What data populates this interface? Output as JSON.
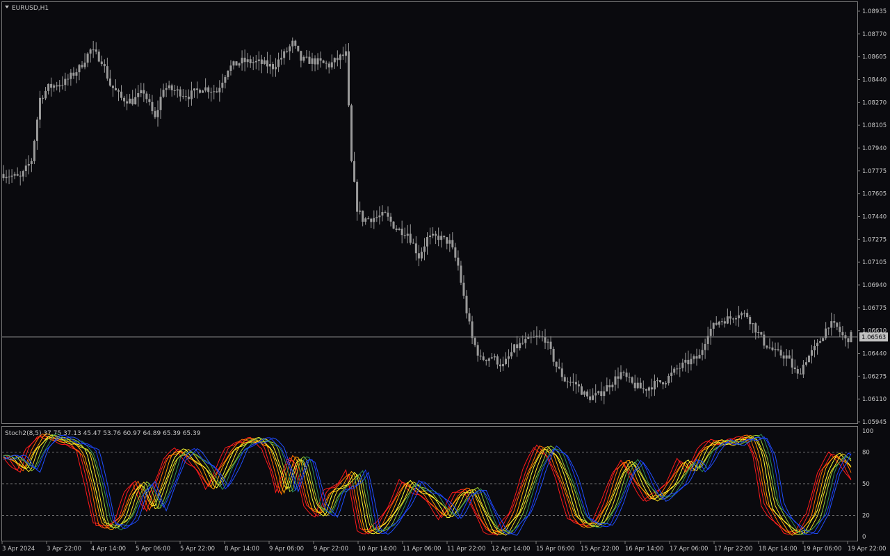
{
  "window": {
    "symbol_label": "EURUSD,H1",
    "current_price": "1.06563",
    "indicator_label": "Stoch2(8,5) 37.75 37.13 45.47 53.76 60.97 64.89 65.39 65.39"
  },
  "colors": {
    "background": "#0a0a0e",
    "frame": "#7a7a7a",
    "candle": "#9a9a9a",
    "price_line": "#8a8a8a",
    "level_line": "#9a9a9a",
    "stoch_lines": [
      "#ff1a1a",
      "#ff2020",
      "#ff6a00",
      "#ffa500",
      "#ffff33",
      "#ffe020",
      "#9acd32",
      "#2e8b57",
      "#1a3cff",
      "#2050ff"
    ]
  },
  "price_axis": {
    "labels": [
      "1.08935",
      "1.08770",
      "1.08605",
      "1.08440",
      "1.08270",
      "1.08105",
      "1.07940",
      "1.07775",
      "1.07605",
      "1.07440",
      "1.07275",
      "1.07105",
      "1.06940",
      "1.06775",
      "1.06610",
      "1.06440",
      "1.06275",
      "1.06110",
      "1.05945"
    ]
  },
  "indicator_axis": {
    "labels": [
      "100",
      "80",
      "50",
      "20",
      "0"
    ],
    "levels": [
      80,
      50,
      20
    ]
  },
  "time_axis": {
    "labels": [
      "3 Apr 2024",
      "3 Apr 22:00",
      "4 Apr 14:00",
      "5 Apr 06:00",
      "5 Apr 22:00",
      "8 Apr 14:00",
      "9 Apr 06:00",
      "9 Apr 22:00",
      "10 Apr 14:00",
      "11 Apr 06:00",
      "11 Apr 22:00",
      "12 Apr 14:00",
      "15 Apr 06:00",
      "15 Apr 22:00",
      "16 Apr 14:00",
      "17 Apr 06:00",
      "17 Apr 22:00",
      "18 Apr 14:00",
      "19 Apr 06:00",
      "19 Apr 22:00"
    ]
  },
  "chart_data": {
    "type": "candlestick",
    "symbol": "EURUSD",
    "timeframe": "H1",
    "ylim": [
      1.05945,
      1.08935
    ],
    "last_price": 1.06563,
    "close_path": [
      [
        0,
        1.0775
      ],
      [
        6,
        1.0772
      ],
      [
        10,
        1.0785
      ],
      [
        13,
        1.083
      ],
      [
        16,
        1.0838
      ],
      [
        22,
        1.0842
      ],
      [
        27,
        1.0852
      ],
      [
        31,
        1.0865
      ],
      [
        35,
        1.0858
      ],
      [
        38,
        1.084
      ],
      [
        42,
        1.083
      ],
      [
        46,
        1.0828
      ],
      [
        50,
        1.0835
      ],
      [
        54,
        1.0815
      ],
      [
        57,
        1.0838
      ],
      [
        62,
        1.0835
      ],
      [
        66,
        1.0832
      ],
      [
        71,
        1.0838
      ],
      [
        76,
        1.0835
      ],
      [
        80,
        1.0852
      ],
      [
        85,
        1.0857
      ],
      [
        91,
        1.0856
      ],
      [
        96,
        1.0853
      ],
      [
        100,
        1.0862
      ],
      [
        103,
        1.087
      ],
      [
        106,
        1.0858
      ],
      [
        111,
        1.0857
      ],
      [
        116,
        1.0854
      ],
      [
        120,
        1.086
      ],
      [
        122,
        1.0862
      ],
      [
        124,
        1.0783
      ],
      [
        126,
        1.075
      ],
      [
        128,
        1.0742
      ],
      [
        132,
        1.0743
      ],
      [
        136,
        1.0745
      ],
      [
        140,
        1.0735
      ],
      [
        144,
        1.0732
      ],
      [
        148,
        1.0715
      ],
      [
        151,
        1.0728
      ],
      [
        155,
        1.0729
      ],
      [
        159,
        1.0725
      ],
      [
        162,
        1.0708
      ],
      [
        164,
        1.0685
      ],
      [
        167,
        1.0655
      ],
      [
        170,
        1.064
      ],
      [
        174,
        1.0642
      ],
      [
        178,
        1.0635
      ],
      [
        182,
        1.0648
      ],
      [
        186,
        1.0653
      ],
      [
        190,
        1.0656
      ],
      [
        193,
        1.0655
      ],
      [
        197,
        1.0635
      ],
      [
        200,
        1.0625
      ],
      [
        204,
        1.0622
      ],
      [
        208,
        1.0612
      ],
      [
        212,
        1.0614
      ],
      [
        216,
        1.0622
      ],
      [
        220,
        1.063
      ],
      [
        224,
        1.0622
      ],
      [
        228,
        1.0618
      ],
      [
        232,
        1.0622
      ],
      [
        236,
        1.0625
      ],
      [
        240,
        1.0633
      ],
      [
        244,
        1.0638
      ],
      [
        248,
        1.0642
      ],
      [
        251,
        1.066
      ],
      [
        255,
        1.0668
      ],
      [
        259,
        1.067
      ],
      [
        262,
        1.0674
      ],
      [
        265,
        1.0672
      ],
      [
        268,
        1.0662
      ],
      [
        271,
        1.0652
      ],
      [
        275,
        1.0645
      ],
      [
        279,
        1.0642
      ],
      [
        283,
        1.0628
      ],
      [
        286,
        1.064
      ],
      [
        290,
        1.065
      ],
      [
        294,
        1.0666
      ],
      [
        297,
        1.0663
      ],
      [
        300,
        1.0654
      ],
      [
        302,
        1.0657
      ]
    ],
    "stoch_k_path": [
      [
        0,
        75
      ],
      [
        5,
        62
      ],
      [
        8,
        82
      ],
      [
        12,
        96
      ],
      [
        17,
        92
      ],
      [
        22,
        88
      ],
      [
        26,
        80
      ],
      [
        29,
        50
      ],
      [
        32,
        12
      ],
      [
        36,
        8
      ],
      [
        40,
        18
      ],
      [
        43,
        40
      ],
      [
        46,
        52
      ],
      [
        50,
        25
      ],
      [
        53,
        45
      ],
      [
        57,
        75
      ],
      [
        61,
        82
      ],
      [
        65,
        72
      ],
      [
        68,
        65
      ],
      [
        72,
        45
      ],
      [
        75,
        62
      ],
      [
        79,
        82
      ],
      [
        83,
        90
      ],
      [
        88,
        92
      ],
      [
        92,
        85
      ],
      [
        95,
        62
      ],
      [
        97,
        40
      ],
      [
        101,
        75
      ],
      [
        103,
        72
      ],
      [
        107,
        28
      ],
      [
        111,
        20
      ],
      [
        114,
        42
      ],
      [
        118,
        48
      ],
      [
        122,
        62
      ],
      [
        126,
        6
      ],
      [
        129,
        4
      ],
      [
        133,
        12
      ],
      [
        137,
        30
      ],
      [
        141,
        52
      ],
      [
        144,
        45
      ],
      [
        148,
        40
      ],
      [
        152,
        28
      ],
      [
        155,
        18
      ],
      [
        160,
        40
      ],
      [
        164,
        45
      ],
      [
        168,
        20
      ],
      [
        171,
        5
      ],
      [
        175,
        3
      ],
      [
        180,
        22
      ],
      [
        185,
        62
      ],
      [
        189,
        85
      ],
      [
        193,
        78
      ],
      [
        197,
        52
      ],
      [
        201,
        18
      ],
      [
        205,
        10
      ],
      [
        209,
        12
      ],
      [
        213,
        32
      ],
      [
        217,
        62
      ],
      [
        220,
        72
      ],
      [
        224,
        50
      ],
      [
        228,
        35
      ],
      [
        232,
        40
      ],
      [
        236,
        52
      ],
      [
        240,
        72
      ],
      [
        243,
        62
      ],
      [
        247,
        82
      ],
      [
        251,
        90
      ],
      [
        256,
        88
      ],
      [
        260,
        92
      ],
      [
        264,
        95
      ],
      [
        267,
        75
      ],
      [
        270,
        30
      ],
      [
        274,
        15
      ],
      [
        278,
        3
      ],
      [
        282,
        5
      ],
      [
        286,
        20
      ],
      [
        290,
        62
      ],
      [
        294,
        78
      ],
      [
        298,
        70
      ],
      [
        302,
        52
      ]
    ],
    "stoch_lines": 10
  }
}
